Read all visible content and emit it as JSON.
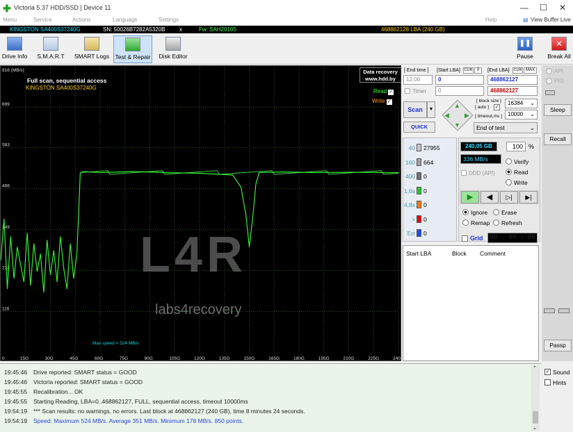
{
  "window": {
    "title": "Victoria 5.37 HDD/SSD | Device 11"
  },
  "menu": {
    "items": [
      "Menu",
      "Service",
      "Actions",
      "Language",
      "Settings"
    ],
    "help": "Help",
    "view_buffer": "View Buffer Live"
  },
  "infobar": {
    "model": "KINGSTON SA400S37240G",
    "serial": "SN: 50026B7282A5320B",
    "close": "x",
    "firmware": "Fw: SAH20105",
    "capacity": "468862128 LBA (240 GB)"
  },
  "toolbar": {
    "drive_info": "Drive Info",
    "smart": "S.M.A.R.T",
    "smart_logs": "SMART Logs",
    "test_repair": "Test & Repair",
    "disk_editor": "Disk Editor",
    "pause": "Pause",
    "break_all": "Break All"
  },
  "graph": {
    "unit": "816 (MB/s)",
    "y_ticks": [
      "699",
      "583",
      "466",
      "349",
      "233",
      "116"
    ],
    "x_ticks": [
      "0",
      "15G",
      "30G",
      "45G",
      "60G",
      "75G",
      "90G",
      "105G",
      "120G",
      "135G",
      "150G",
      "165G",
      "180G",
      "195G",
      "210G",
      "225G",
      "240"
    ],
    "title": "Full scan, sequential access",
    "subtitle": "KINGSTON SA400S37240G",
    "badge1": "Data recovery",
    "badge2": "www.hdd.by",
    "read_label": "Read",
    "write_label": "Write",
    "watermark_logo": "L4R",
    "watermark_text": "labs4recovery",
    "max_speed": "Max speed = 524 MB/s"
  },
  "chart_data": {
    "type": "line",
    "xlabel": "",
    "ylabel": "816 (MB/s)",
    "xlim": [
      0,
      240
    ],
    "ylim": [
      0,
      816
    ],
    "series": [
      {
        "values": [
          [
            0,
            260
          ],
          [
            2,
            380
          ],
          [
            4,
            180
          ],
          [
            6,
            330
          ],
          [
            8,
            210
          ],
          [
            10,
            300
          ],
          [
            12,
            250
          ],
          [
            14,
            200
          ],
          [
            16,
            340
          ],
          [
            18,
            190
          ],
          [
            20,
            310
          ],
          [
            22,
            230
          ],
          [
            24,
            280
          ],
          [
            26,
            170
          ],
          [
            28,
            320
          ],
          [
            30,
            220
          ],
          [
            32,
            290
          ],
          [
            34,
            200
          ],
          [
            36,
            330
          ],
          [
            38,
            240
          ],
          [
            40,
            180
          ],
          [
            42,
            310
          ],
          [
            44,
            210
          ],
          [
            46,
            280
          ],
          [
            48,
            510
          ],
          [
            50,
            515
          ],
          [
            60,
            512
          ],
          [
            80,
            515
          ],
          [
            100,
            512
          ],
          [
            120,
            510
          ],
          [
            140,
            505
          ],
          [
            145,
            470
          ],
          [
            148,
            390
          ],
          [
            150,
            300
          ],
          [
            152,
            380
          ],
          [
            154,
            480
          ],
          [
            156,
            512
          ],
          [
            170,
            514
          ],
          [
            190,
            512
          ],
          [
            210,
            513
          ],
          [
            230,
            512
          ],
          [
            240,
            512
          ]
        ]
      }
    ]
  },
  "panel": {
    "end_time_label": "[ End time ]",
    "start_lba_label": "[Start LBA]",
    "cur_label1": "CUR",
    "zero_label": "0",
    "end_lba_label": "[End LBA]",
    "cur_label2": "CUR",
    "max_label": "MAX",
    "end_time_value": "12:00",
    "start_lba_value": "0",
    "end_lba_value": "468862127",
    "end_lba_max": "468862127",
    "timer_label": "Timer",
    "timer_value": "0",
    "scan_label": "Scan",
    "quick_label": "QUICK",
    "block_size_label": "[ block size ]",
    "auto_label": "[ auto ]",
    "timeout_label": "[ timeout,ms ]",
    "block_size": "16384",
    "timeout": "10000",
    "end_mode": "End of test",
    "counts": [
      {
        "label": "40",
        "value": "27955",
        "color": "#c8c8c8"
      },
      {
        "label": "160",
        "value": "664",
        "color": "#a0a0a0"
      },
      {
        "label": "400",
        "value": "0",
        "color": "#707070"
      },
      {
        "label": "1,6s",
        "value": "0",
        "color": "#22cc22"
      },
      {
        "label": "4,8s",
        "value": "0",
        "color": "#ff7b00"
      },
      {
        "label": ">",
        "value": "0",
        "color": "#ff0000"
      },
      {
        "label": "Err",
        "value": "0",
        "color": "#1a4dff"
      }
    ],
    "scanned_gb": "240,05 GB",
    "percent": "100",
    "percent_unit": "%",
    "speed": "336 MB/s",
    "ddd_label": "DDD (API)",
    "verify_label": "Verify",
    "read_label": "Read",
    "write_label": "Write",
    "ignore_label": "Ignore",
    "erase_label": "Erase",
    "remap_label": "Remap",
    "refresh_label": "Refresh",
    "grid_label": "Grid",
    "grid_time": "00 : 00 : 00",
    "table_headers": [
      "Start LBA",
      "Block",
      "Comment"
    ]
  },
  "right": {
    "api": "API",
    "pio": "PIO",
    "sleep": "Sleep",
    "recall": "Recall",
    "passp": "Passp",
    "sound": "Sound",
    "hints": "Hints"
  },
  "log": [
    {
      "time": "19:45:46",
      "text": "Drive reported: SMART status = GOOD",
      "color": "#222"
    },
    {
      "time": "19:45:46",
      "text": "Victoria reported: SMART status = GOOD",
      "color": "#222"
    },
    {
      "time": "19:45:55",
      "text": "Recalibration... OK",
      "color": "#222"
    },
    {
      "time": "19:45:55",
      "text": "Starting Reading, LBA=0..468862127, FULL, sequential access, timeout 10000ms",
      "color": "#222"
    },
    {
      "time": "19:54:19",
      "text": "*** Scan results: no warnings, no errors. Last block at 468862127 (240 GB), time 8 minutes 24 seconds.",
      "color": "#222"
    },
    {
      "time": "19:54:19",
      "text": "Speed: Maximum 524 MB/s. Average 351 MB/s. Minimum 178 MB/s. 850 points.",
      "color": "#2a3fe0"
    }
  ]
}
